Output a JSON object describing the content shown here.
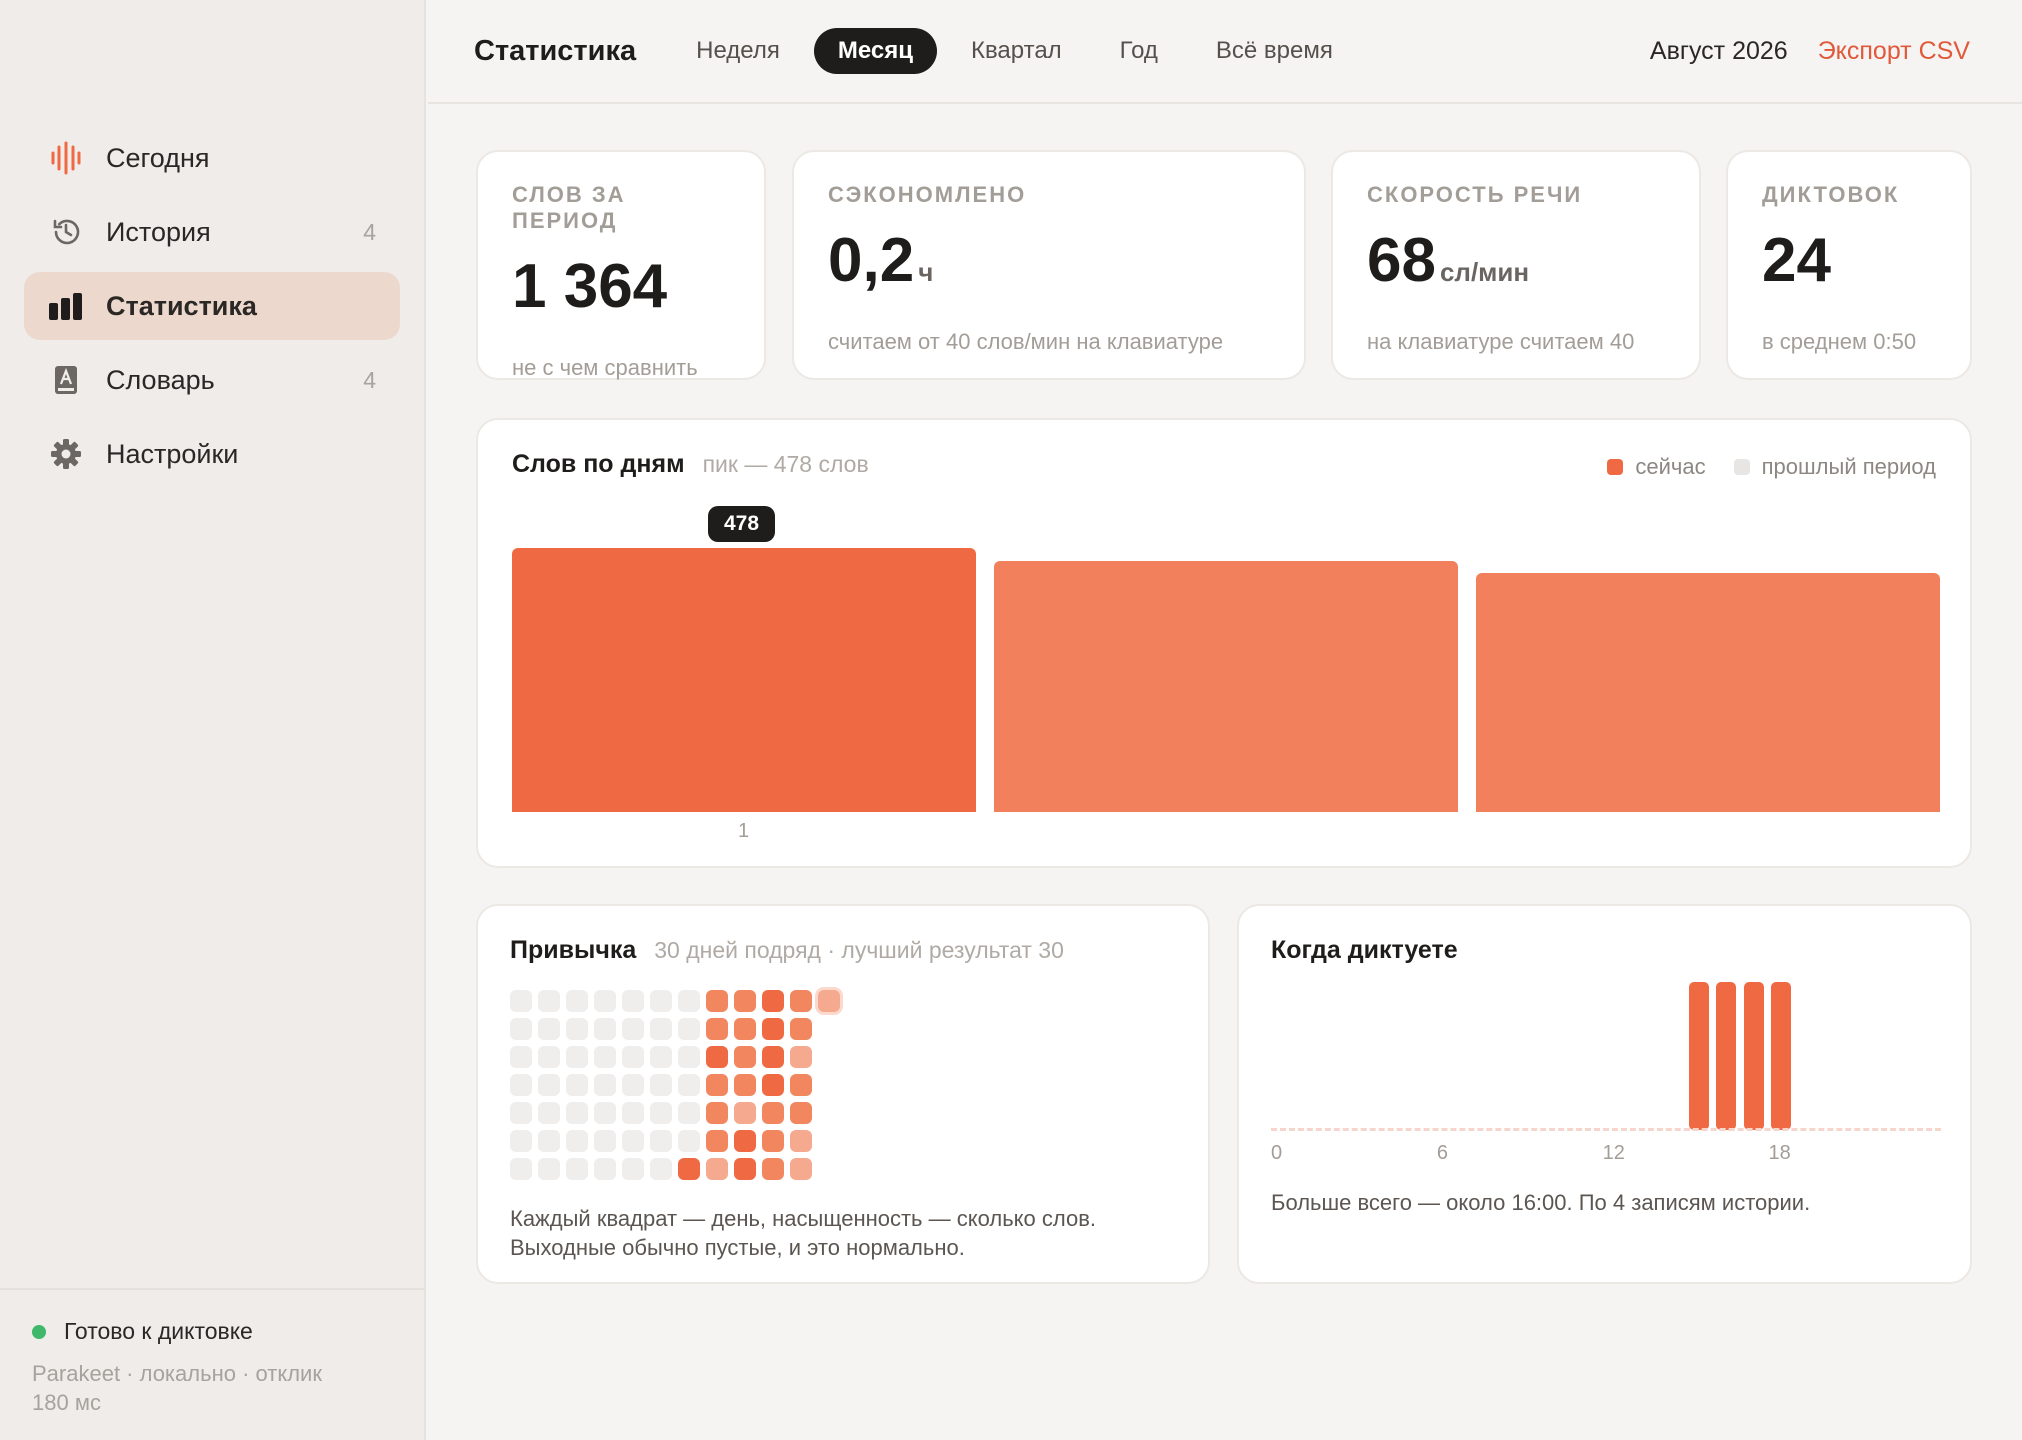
{
  "sidebar": {
    "items": [
      {
        "label": "Сегодня",
        "count": "",
        "icon": "waveform-icon"
      },
      {
        "label": "История",
        "count": "4",
        "icon": "history-icon"
      },
      {
        "label": "Статистика",
        "count": "",
        "icon": "bar-chart-icon",
        "active": true
      },
      {
        "label": "Словарь",
        "count": "4",
        "icon": "dictionary-icon"
      },
      {
        "label": "Настройки",
        "count": "",
        "icon": "gear-icon"
      }
    ],
    "status": {
      "label": "Готово к диктовке",
      "detail": "Parakeet · локально · отклик 180 мс",
      "color": "#3fb86a"
    }
  },
  "header": {
    "title": "Статистика",
    "tabs": [
      "Неделя",
      "Месяц",
      "Квартал",
      "Год",
      "Всё время"
    ],
    "active_tab": "Месяц",
    "period": "Август 2026",
    "export": "Экспорт CSV"
  },
  "stats": [
    {
      "label": "СЛОВ ЗА ПЕРИОД",
      "value": "1 364",
      "unit": "",
      "note": "не с чем сравнить"
    },
    {
      "label": "СЭКОНОМЛЕНО",
      "value": "0,2",
      "unit": "ч",
      "note": "считаем от 40 слов/мин на клавиатуре"
    },
    {
      "label": "СКОРОСТЬ РЕЧИ",
      "value": "68",
      "unit": "сл/мин",
      "note": "на клавиатуре считаем 40"
    },
    {
      "label": "ДИКТОВОК",
      "value": "24",
      "unit": "",
      "note": "в среднем 0:50"
    }
  ],
  "words_chart": {
    "title": "Слов по дням",
    "subtitle": "пик — 478 слов",
    "legend": [
      {
        "label": "сейчас",
        "color": "#ef6a42"
      },
      {
        "label": "прошлый период",
        "color": "#e8e6e4"
      }
    ],
    "tooltip": "478",
    "x_label": "1"
  },
  "chart_data": {
    "type": "bar",
    "categories": [
      "1",
      "",
      ""
    ],
    "values": [
      478,
      455,
      432
    ],
    "ylim": [
      0,
      478
    ],
    "colors": [
      "#ef6a42",
      "#f2805c",
      "#f2805c"
    ]
  },
  "habit": {
    "title": "Привычка",
    "subtitle": "30 дней подряд · лучший результат 30",
    "text_line1": "Каждый квадрат — день, насыщенность — сколько слов.",
    "text_line2": "Выходные обычно пустые, и это нормально."
  },
  "hours": {
    "title": "Когда диктуете",
    "ticks": [
      "0",
      "6",
      "12",
      "18"
    ],
    "active_hours": [
      16,
      17,
      18,
      19
    ],
    "summary": "Больше всего — около 16:00. По 4 записям истории."
  }
}
